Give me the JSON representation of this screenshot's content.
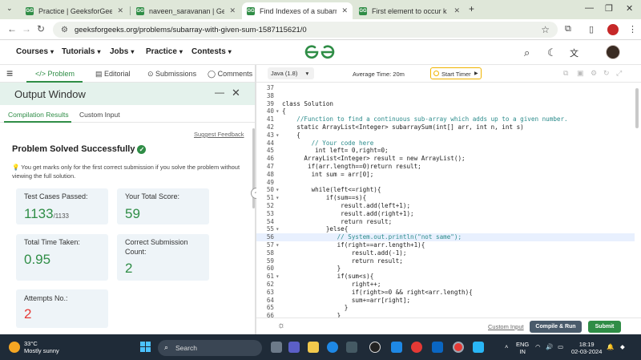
{
  "browser": {
    "tabs": [
      {
        "title": "Practice | GeeksforGeeks | A co",
        "active": false
      },
      {
        "title": "naveen_saravanan | GeeksforGe",
        "active": false
      },
      {
        "title": "Find Indexes of a subarray with",
        "active": true
      },
      {
        "title": "First element to occur k times |",
        "active": false
      }
    ],
    "url": "geeksforgeeks.org/problems/subarray-with-given-sum-1587115621/0"
  },
  "site": {
    "logo": "GfG",
    "menu": [
      "Courses",
      "Tutorials",
      "Jobs",
      "Practice",
      "Contests"
    ]
  },
  "problem_tabs": [
    "Problem",
    "Editorial",
    "Submissions",
    "Comments"
  ],
  "output_window": {
    "title": "Output Window",
    "tabs": [
      "Compilation Results",
      "Custom Input"
    ],
    "suggest_feedback": "Suggest Feedback",
    "status": "Problem Solved Successfully",
    "note": "You get marks only for the first correct submission if you solve the problem without viewing the full solution.",
    "stats": {
      "test_cases_label": "Test Cases Passed:",
      "test_cases_value": "1133",
      "test_cases_total": "/1133",
      "score_label": "Your Total Score:",
      "score_value": "59",
      "time_label": "Total Time Taken:",
      "time_value": "0.95",
      "correct_label": "Correct Submission Count:",
      "correct_value": "2",
      "attempts_label": "Attempts No.:",
      "attempts_value": "2"
    }
  },
  "editor": {
    "language": "Java (1.8)",
    "avg_time": "Average Time: 20m",
    "timer": "Start Timer",
    "code_lines": [
      {
        "n": "37",
        "fold": "",
        "text": ""
      },
      {
        "n": "38",
        "fold": "",
        "text": ""
      },
      {
        "n": "39",
        "fold": "",
        "text": "class Solution"
      },
      {
        "n": "40",
        "fold": "▾",
        "text": "{"
      },
      {
        "n": "41",
        "fold": "",
        "text": "    //Function to find a continuous sub-array which adds up to a given number.",
        "comment": true
      },
      {
        "n": "42",
        "fold": "",
        "text": "    static ArrayList<Integer> subarraySum(int[] arr, int n, int s)"
      },
      {
        "n": "43",
        "fold": "▾",
        "text": "    {"
      },
      {
        "n": "44",
        "fold": "",
        "text": "        // Your code here",
        "comment": true
      },
      {
        "n": "45",
        "fold": "",
        "text": "         int left= 0,right=0;"
      },
      {
        "n": "46",
        "fold": "",
        "text": "      ArrayList<Integer> result = new ArrayList();"
      },
      {
        "n": "47",
        "fold": "",
        "text": "       if(arr.length==0)return result;"
      },
      {
        "n": "48",
        "fold": "",
        "text": "        int sum = arr[0];"
      },
      {
        "n": "49",
        "fold": "",
        "text": ""
      },
      {
        "n": "50",
        "fold": "▾",
        "text": "        while(left<=right){"
      },
      {
        "n": "51",
        "fold": "▾",
        "text": "            if(sum==s){"
      },
      {
        "n": "52",
        "fold": "",
        "text": "                result.add(left+1);"
      },
      {
        "n": "53",
        "fold": "",
        "text": "                result.add(right+1);"
      },
      {
        "n": "54",
        "fold": "",
        "text": "                return result;"
      },
      {
        "n": "55",
        "fold": "▾",
        "text": "            }else{"
      },
      {
        "n": "56",
        "fold": "",
        "text": "               // System.out.println(\"not same\");",
        "comment": true,
        "current": true
      },
      {
        "n": "57",
        "fold": "▾",
        "text": "               if(right==arr.length+1){"
      },
      {
        "n": "58",
        "fold": "",
        "text": "                   result.add(-1);"
      },
      {
        "n": "59",
        "fold": "",
        "text": "                   return result;"
      },
      {
        "n": "60",
        "fold": "",
        "text": "               }"
      },
      {
        "n": "61",
        "fold": "▾",
        "text": "               if(sum<s){"
      },
      {
        "n": "62",
        "fold": "",
        "text": "                   right++;"
      },
      {
        "n": "63",
        "fold": "",
        "text": "                   if(right>=0 && right<arr.length){"
      },
      {
        "n": "64",
        "fold": "",
        "text": "                   sum+=arr[right];"
      },
      {
        "n": "65",
        "fold": "",
        "text": "                 }"
      },
      {
        "n": "66",
        "fold": "",
        "text": "               }"
      }
    ],
    "custom_input": "Custom Input",
    "compile_run": "Compile & Run",
    "submit": "Submit"
  },
  "taskbar": {
    "temperature": "33°C",
    "weather": "Mostly sunny",
    "search": "Search",
    "lang_top": "ENG",
    "lang_bottom": "IN",
    "time": "18:19",
    "date": "02-03-2024"
  }
}
